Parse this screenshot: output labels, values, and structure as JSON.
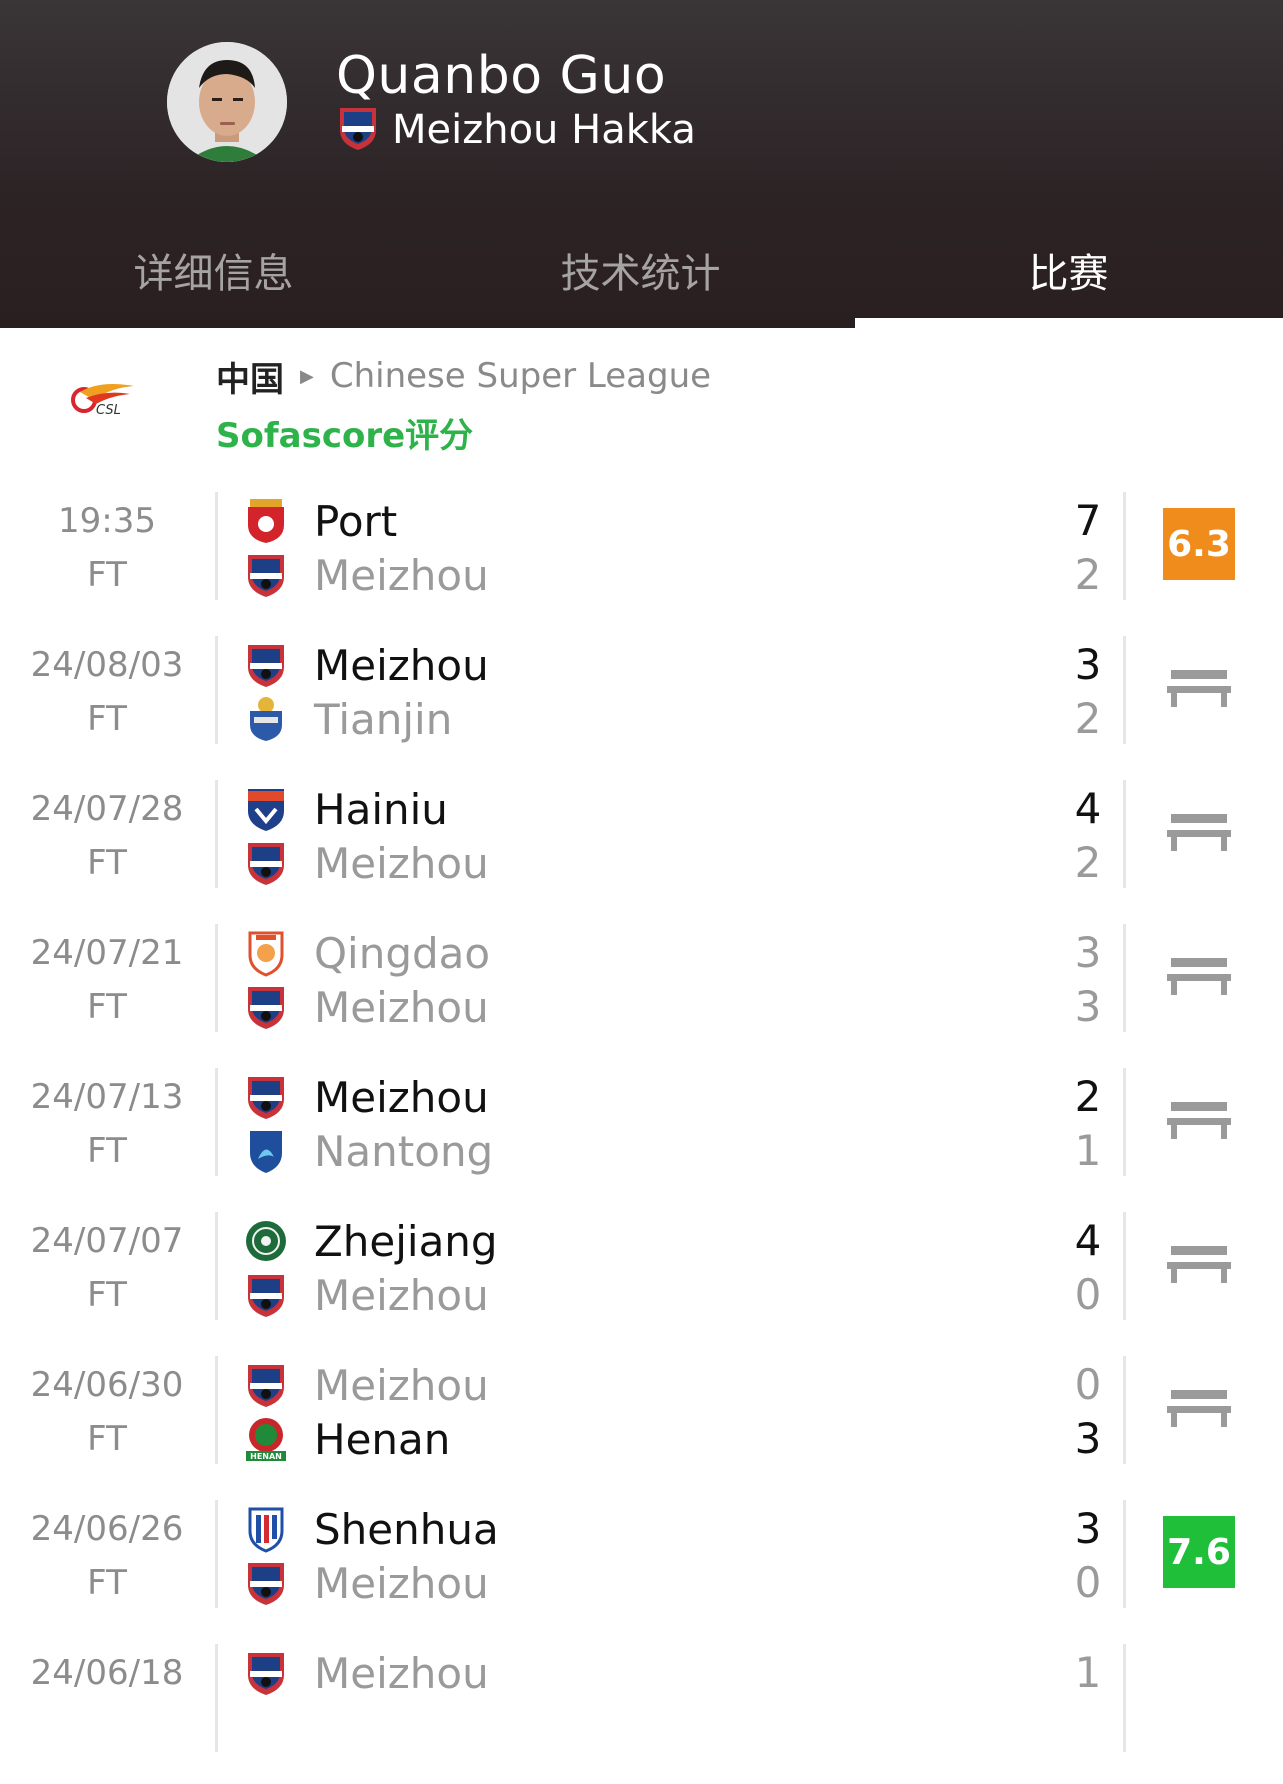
{
  "player": {
    "name": "Quanbo Guo",
    "team": "Meizhou Hakka"
  },
  "tabs": [
    "详细信息",
    "技术统计",
    "比赛"
  ],
  "active_tab": 2,
  "league": {
    "country": "中国",
    "name": "Chinese Super League",
    "logo_text": "CSL",
    "rating_label": "Sofascore评分"
  },
  "colors": {
    "win_rating": "#1fbf3a",
    "mid_rating": "#f08c1c",
    "bench": "#9a9a9a",
    "rating_label": "#2eb24a"
  },
  "matches": [
    {
      "date": "19:35",
      "status": "FT",
      "home": "Port",
      "away": "Meizhou",
      "home_score": "7",
      "away_score": "2",
      "home_win": true,
      "away_win": false,
      "home_crest": "port-crest",
      "away_crest": "meizhou-crest",
      "rating": "6.3",
      "rating_color": "#f08c1c"
    },
    {
      "date": "24/08/03",
      "status": "FT",
      "home": "Meizhou",
      "away": "Tianjin",
      "home_score": "3",
      "away_score": "2",
      "home_win": true,
      "away_win": false,
      "home_crest": "meizhou-crest",
      "away_crest": "tianjin-crest",
      "rating": null
    },
    {
      "date": "24/07/28",
      "status": "FT",
      "home": "Hainiu",
      "away": "Meizhou",
      "home_score": "4",
      "away_score": "2",
      "home_win": true,
      "away_win": false,
      "home_crest": "hainiu-crest",
      "away_crest": "meizhou-crest",
      "rating": null
    },
    {
      "date": "24/07/21",
      "status": "FT",
      "home": "Qingdao",
      "away": "Meizhou",
      "home_score": "3",
      "away_score": "3",
      "home_win": false,
      "away_win": false,
      "home_crest": "qingdao-crest",
      "away_crest": "meizhou-crest",
      "rating": null
    },
    {
      "date": "24/07/13",
      "status": "FT",
      "home": "Meizhou",
      "away": "Nantong",
      "home_score": "2",
      "away_score": "1",
      "home_win": true,
      "away_win": false,
      "home_crest": "meizhou-crest",
      "away_crest": "nantong-crest",
      "rating": null
    },
    {
      "date": "24/07/07",
      "status": "FT",
      "home": "Zhejiang",
      "away": "Meizhou",
      "home_score": "4",
      "away_score": "0",
      "home_win": true,
      "away_win": false,
      "home_crest": "zhejiang-crest",
      "away_crest": "meizhou-crest",
      "rating": null
    },
    {
      "date": "24/06/30",
      "status": "FT",
      "home": "Meizhou",
      "away": "Henan",
      "home_score": "0",
      "away_score": "3",
      "home_win": false,
      "away_win": true,
      "home_crest": "meizhou-crest",
      "away_crest": "henan-crest",
      "rating": null
    },
    {
      "date": "24/06/26",
      "status": "FT",
      "home": "Shenhua",
      "away": "Meizhou",
      "home_score": "3",
      "away_score": "0",
      "home_win": true,
      "away_win": false,
      "home_crest": "shenhua-crest",
      "away_crest": "meizhou-crest",
      "rating": "7.6",
      "rating_color": "#1fbf3a"
    },
    {
      "date": "24/06/18",
      "status": "",
      "home": "Meizhou",
      "away": "",
      "home_score": "1",
      "away_score": "",
      "home_win": false,
      "away_win": false,
      "home_crest": "meizhou-crest",
      "away_crest": "",
      "rating": null
    }
  ]
}
